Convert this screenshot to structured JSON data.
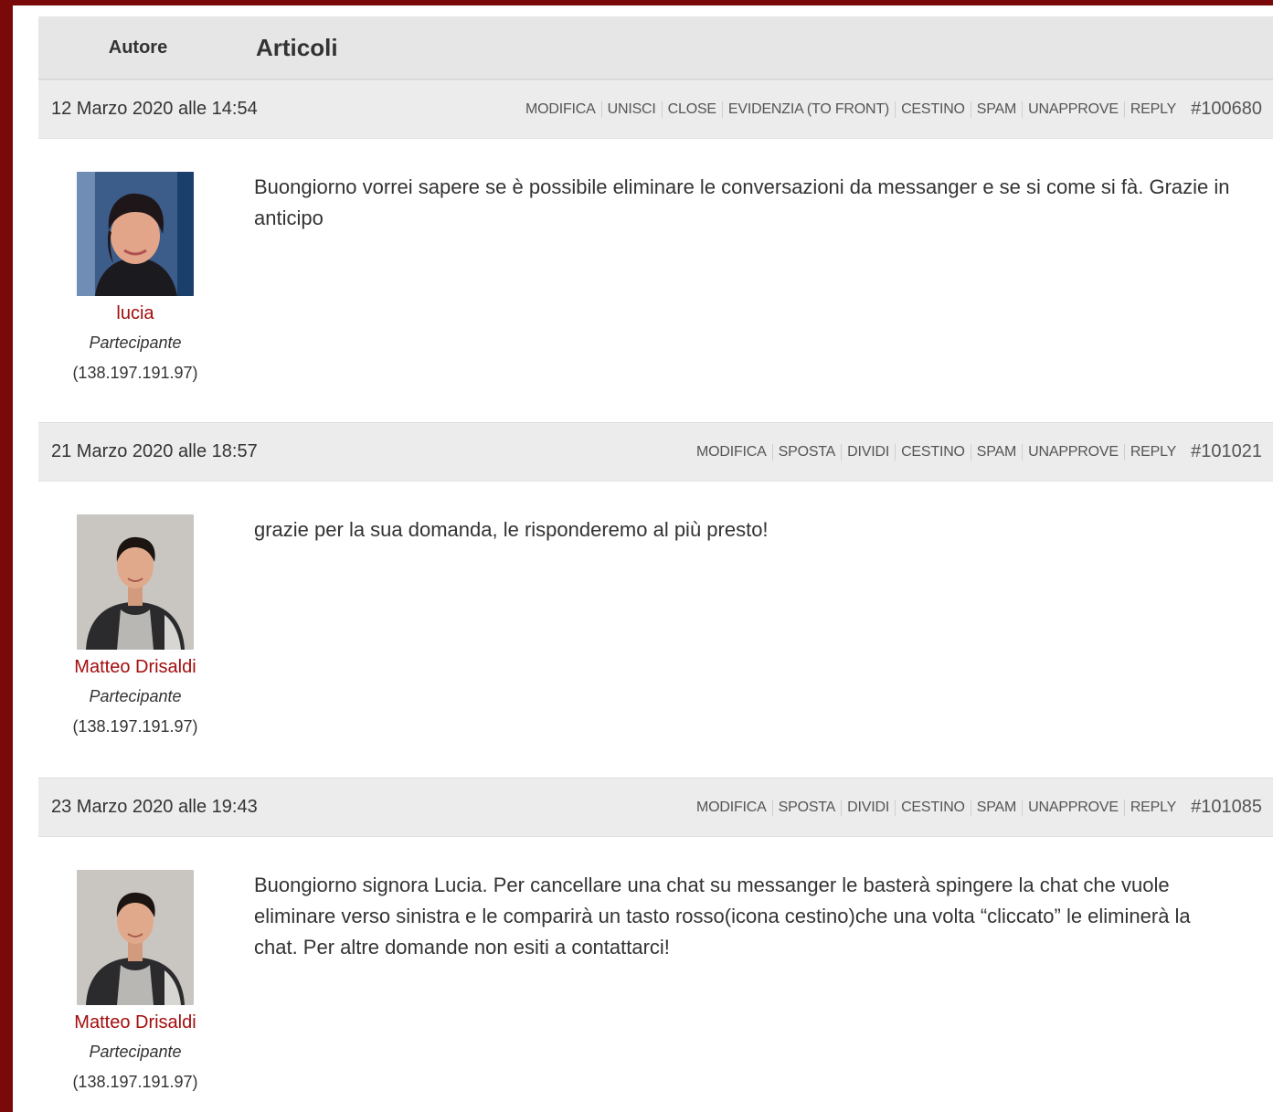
{
  "table_header": {
    "author": "Autore",
    "topics": "Articoli"
  },
  "posts": [
    {
      "date": "12 Marzo 2020 alle 14:54",
      "actions": [
        "MODIFICA",
        "UNISCI",
        "CLOSE",
        "EVIDENZIA (TO FRONT)",
        "CESTINO",
        "SPAM",
        "UNAPPROVE",
        "REPLY"
      ],
      "id": "#100680",
      "author": {
        "name": "lucia",
        "role": "Partecipante",
        "ip": "(138.197.191.97)",
        "avatar": "avatar-woman-photo"
      },
      "content": "Buongiorno vorrei sapere se è possibile eliminare le conversazioni da messanger e se si come si fà. Grazie in anticipo"
    },
    {
      "date": "21 Marzo 2020 alle 18:57",
      "actions": [
        "MODIFICA",
        "SPOSTA",
        "DIVIDI",
        "CESTINO",
        "SPAM",
        "UNAPPROVE",
        "REPLY"
      ],
      "id": "#101021",
      "author": {
        "name": "Matteo Drisaldi",
        "role": "Partecipante",
        "ip": "(138.197.191.97)",
        "avatar": "avatar-young-man-photo"
      },
      "content": "grazie per la sua domanda, le risponderemo al più presto!"
    },
    {
      "date": "23 Marzo 2020 alle 19:43",
      "actions": [
        "MODIFICA",
        "SPOSTA",
        "DIVIDI",
        "CESTINO",
        "SPAM",
        "UNAPPROVE",
        "REPLY"
      ],
      "id": "#101085",
      "author": {
        "name": "Matteo Drisaldi",
        "role": "Partecipante",
        "ip": "(138.197.191.97)",
        "avatar": "avatar-young-man-photo"
      },
      "content": "Buongiorno signora Lucia. Per cancellare una chat su messanger le basterà spingere la chat che vuole eliminare verso sinistra e le comparirà un tasto rosso(icona cestino)che una volta “cliccato” le eliminerà la chat. Per altre domande non esiti a contattarci!"
    }
  ],
  "colors": {
    "page_border": "#7a0a0a",
    "author_link": "#a30d0d",
    "header_bg": "#e6e6e6",
    "post_header_bg": "#ececec"
  }
}
